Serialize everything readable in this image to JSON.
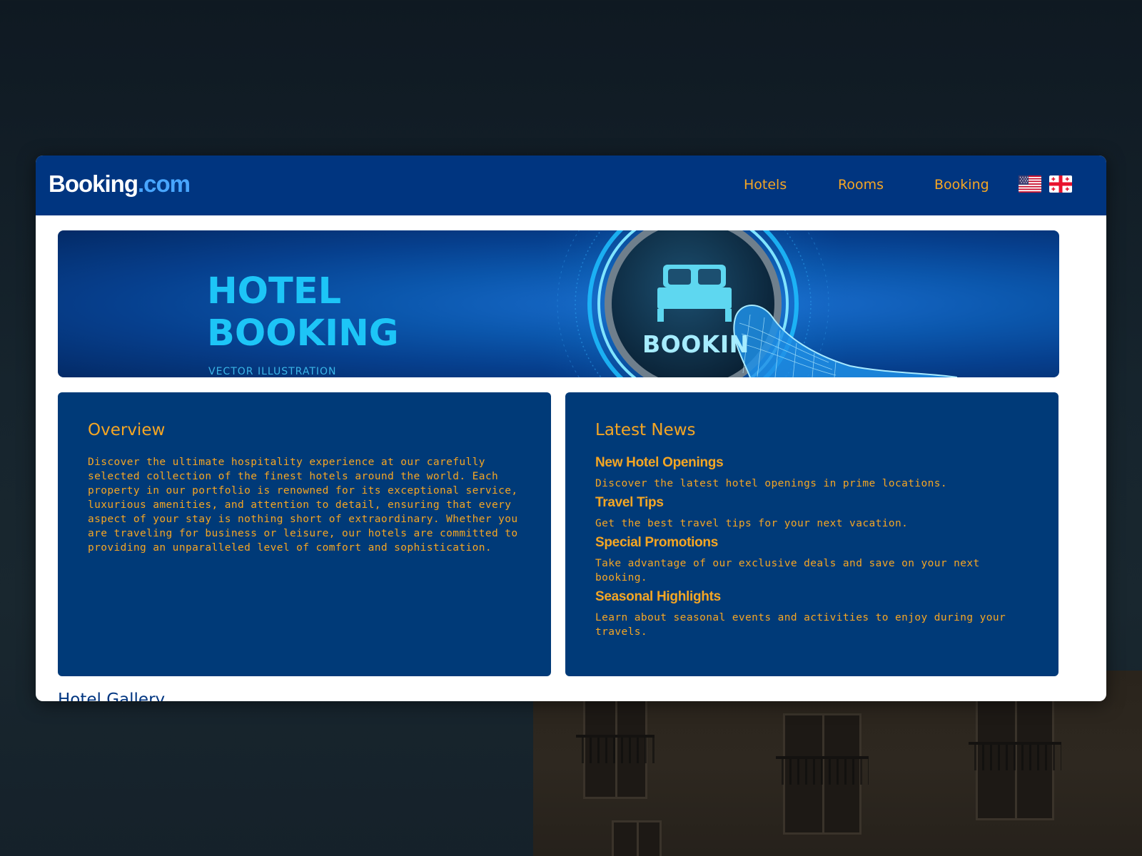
{
  "header": {
    "logo": {
      "brand": "Booking",
      "suffix": ".com"
    },
    "nav": [
      {
        "label": "Hotels"
      },
      {
        "label": "Rooms"
      },
      {
        "label": "Booking"
      }
    ],
    "flags": [
      "us-flag-icon",
      "georgia-flag-icon"
    ]
  },
  "hero": {
    "title": "HOTEL\nBOOKING",
    "subtitle": "VECTOR ILLUSTRATION",
    "button_label": "BOOKIN"
  },
  "overview": {
    "title": "Overview",
    "text": "Discover the ultimate hospitality experience at our carefully selected collection of the finest hotels around the world. Each property in our portfolio is renowned for its exceptional service, luxurious amenities, and attention to detail, ensuring that every aspect of your stay is nothing short of extraordinary. Whether you are traveling for business or leisure, our hotels are committed to providing an unparalleled level of comfort and sophistication."
  },
  "news": {
    "title": "Latest News",
    "items": [
      {
        "heading": "New Hotel Openings",
        "desc": "Discover the latest hotel openings in prime locations."
      },
      {
        "heading": "Travel Tips",
        "desc": "Get the best travel tips for your next vacation."
      },
      {
        "heading": "Special Promotions",
        "desc": "Take advantage of our exclusive deals and save on your next booking."
      },
      {
        "heading": "Seasonal Highlights",
        "desc": "Learn about seasonal events and activities to enjoy during your travels."
      }
    ]
  },
  "gallery": {
    "title": "Hotel Gallery"
  },
  "colors": {
    "navbar": "#003580",
    "card": "#003a78",
    "accent": "#f5a623",
    "hero_text": "#1dc5f7"
  }
}
